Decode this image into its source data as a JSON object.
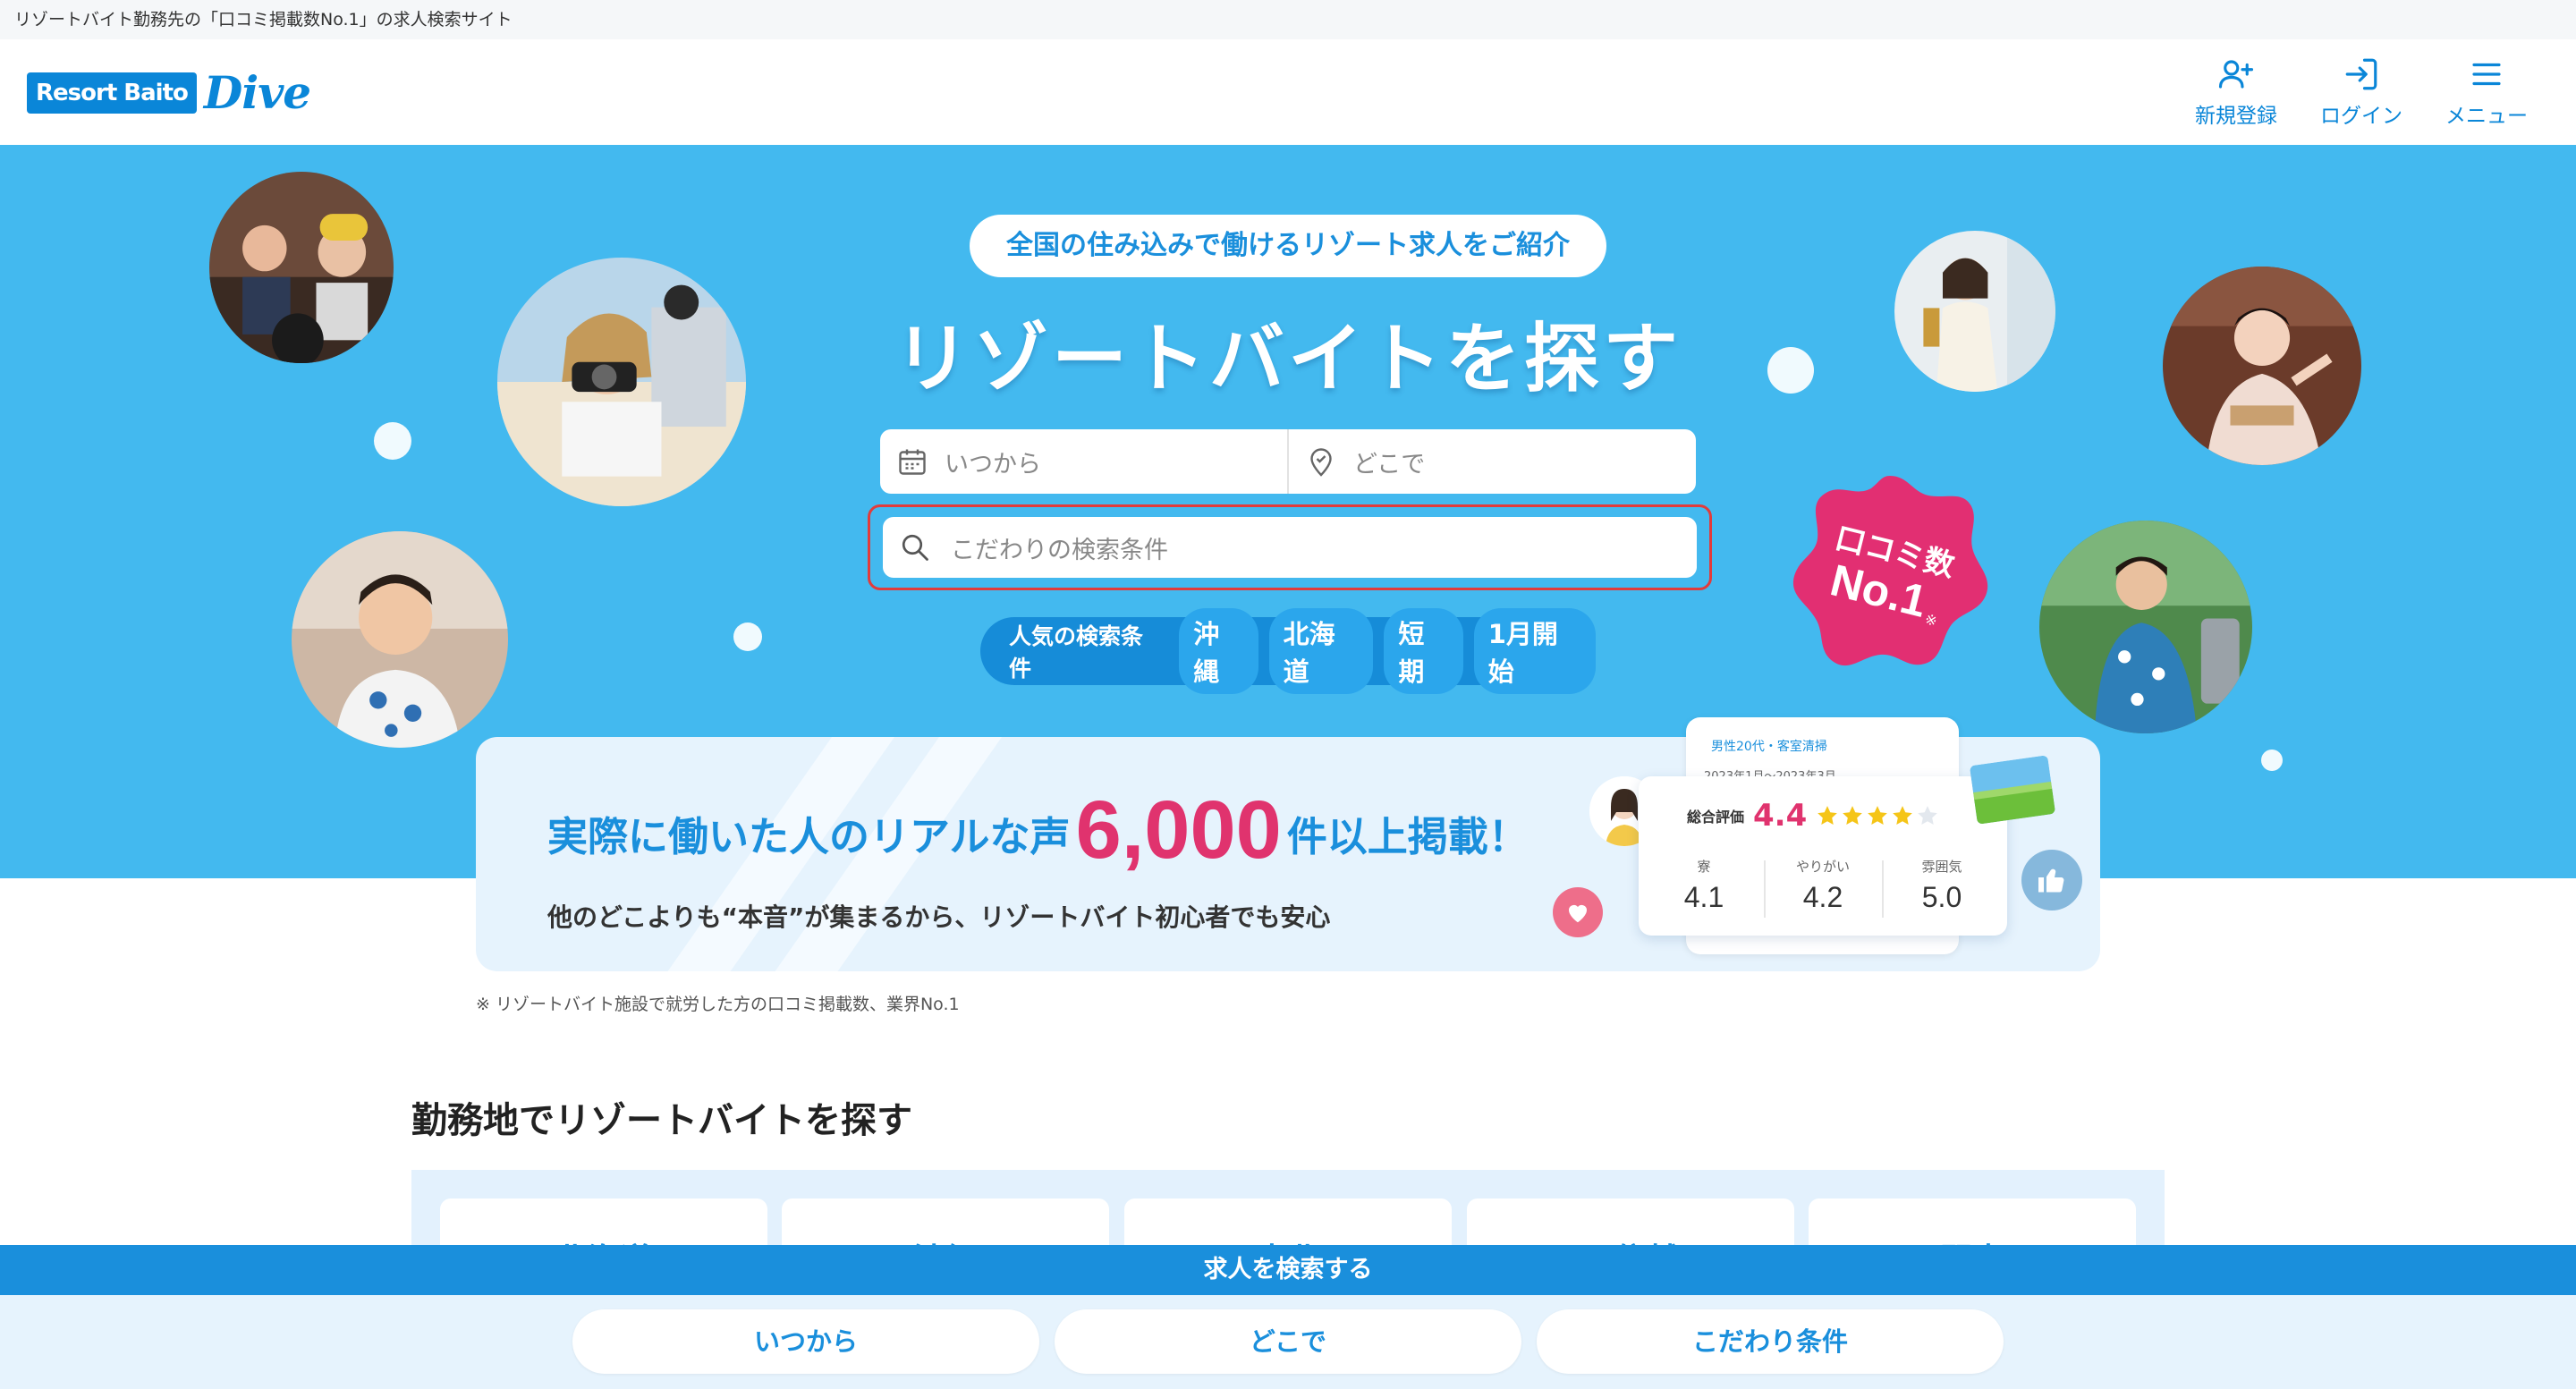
{
  "tagline": "リゾートバイト勤務先の「口コミ掲載数No.1」の求人検索サイト",
  "logo": {
    "box_text": "Resort Baito",
    "script_text": "Dive"
  },
  "header": {
    "nav": [
      {
        "label": "新規登録",
        "icon": "add-user-icon"
      },
      {
        "label": "ログイン",
        "icon": "login-icon"
      },
      {
        "label": "メニュー",
        "icon": "hamburger-icon"
      }
    ]
  },
  "hero": {
    "pill": "全国の住み込みで働けるリゾート求人をご紹介",
    "title": "リゾートバイトを探す",
    "when_placeholder": "いつから",
    "where_placeholder": "どこで",
    "keyword_placeholder": "こだわりの検索条件",
    "popular_label": "人気の検索条件",
    "popular_chips": [
      "沖縄",
      "北海道",
      "短期",
      "1月開始"
    ],
    "badge": {
      "line1": "口コミ数",
      "line2": "No.1",
      "mark": "※"
    }
  },
  "banner": {
    "line1_pre": "実際に働いた人のリアルな声",
    "line1_big": "6,000",
    "line1_post": "件以上掲載！",
    "line2": "他のどこよりも“本音”が集まるから、リゾートバイト初心者でも安心",
    "card_back_tag": "男性20代・客室清掃",
    "card_back_period": "2023年1月〜2023年3月",
    "overall_label": "総合評価",
    "overall_score": "4.4",
    "stars_filled": 4,
    "stars_total": 5,
    "sub_scores": [
      {
        "label": "寮",
        "value": "4.1"
      },
      {
        "label": "やりがい",
        "value": "4.2"
      },
      {
        "label": "雰囲気",
        "value": "5.0"
      }
    ]
  },
  "note": "※ リゾートバイト施設で就労した方の口コミ掲載数、業界No.1",
  "area_section": {
    "title": "勤務地でリゾートバイトを探す",
    "cards": [
      "北海道",
      "沖縄",
      "東北",
      "甲信越",
      "関東"
    ]
  },
  "search_bar": {
    "title": "求人を検索する",
    "buttons": [
      "いつから",
      "どこで",
      "こだわり条件"
    ]
  },
  "colors": {
    "brand_blue": "#1a8fdc",
    "hero_bg": "#43b9ef",
    "pink": "#e0336e",
    "highlight_border": "#e23b3b"
  }
}
